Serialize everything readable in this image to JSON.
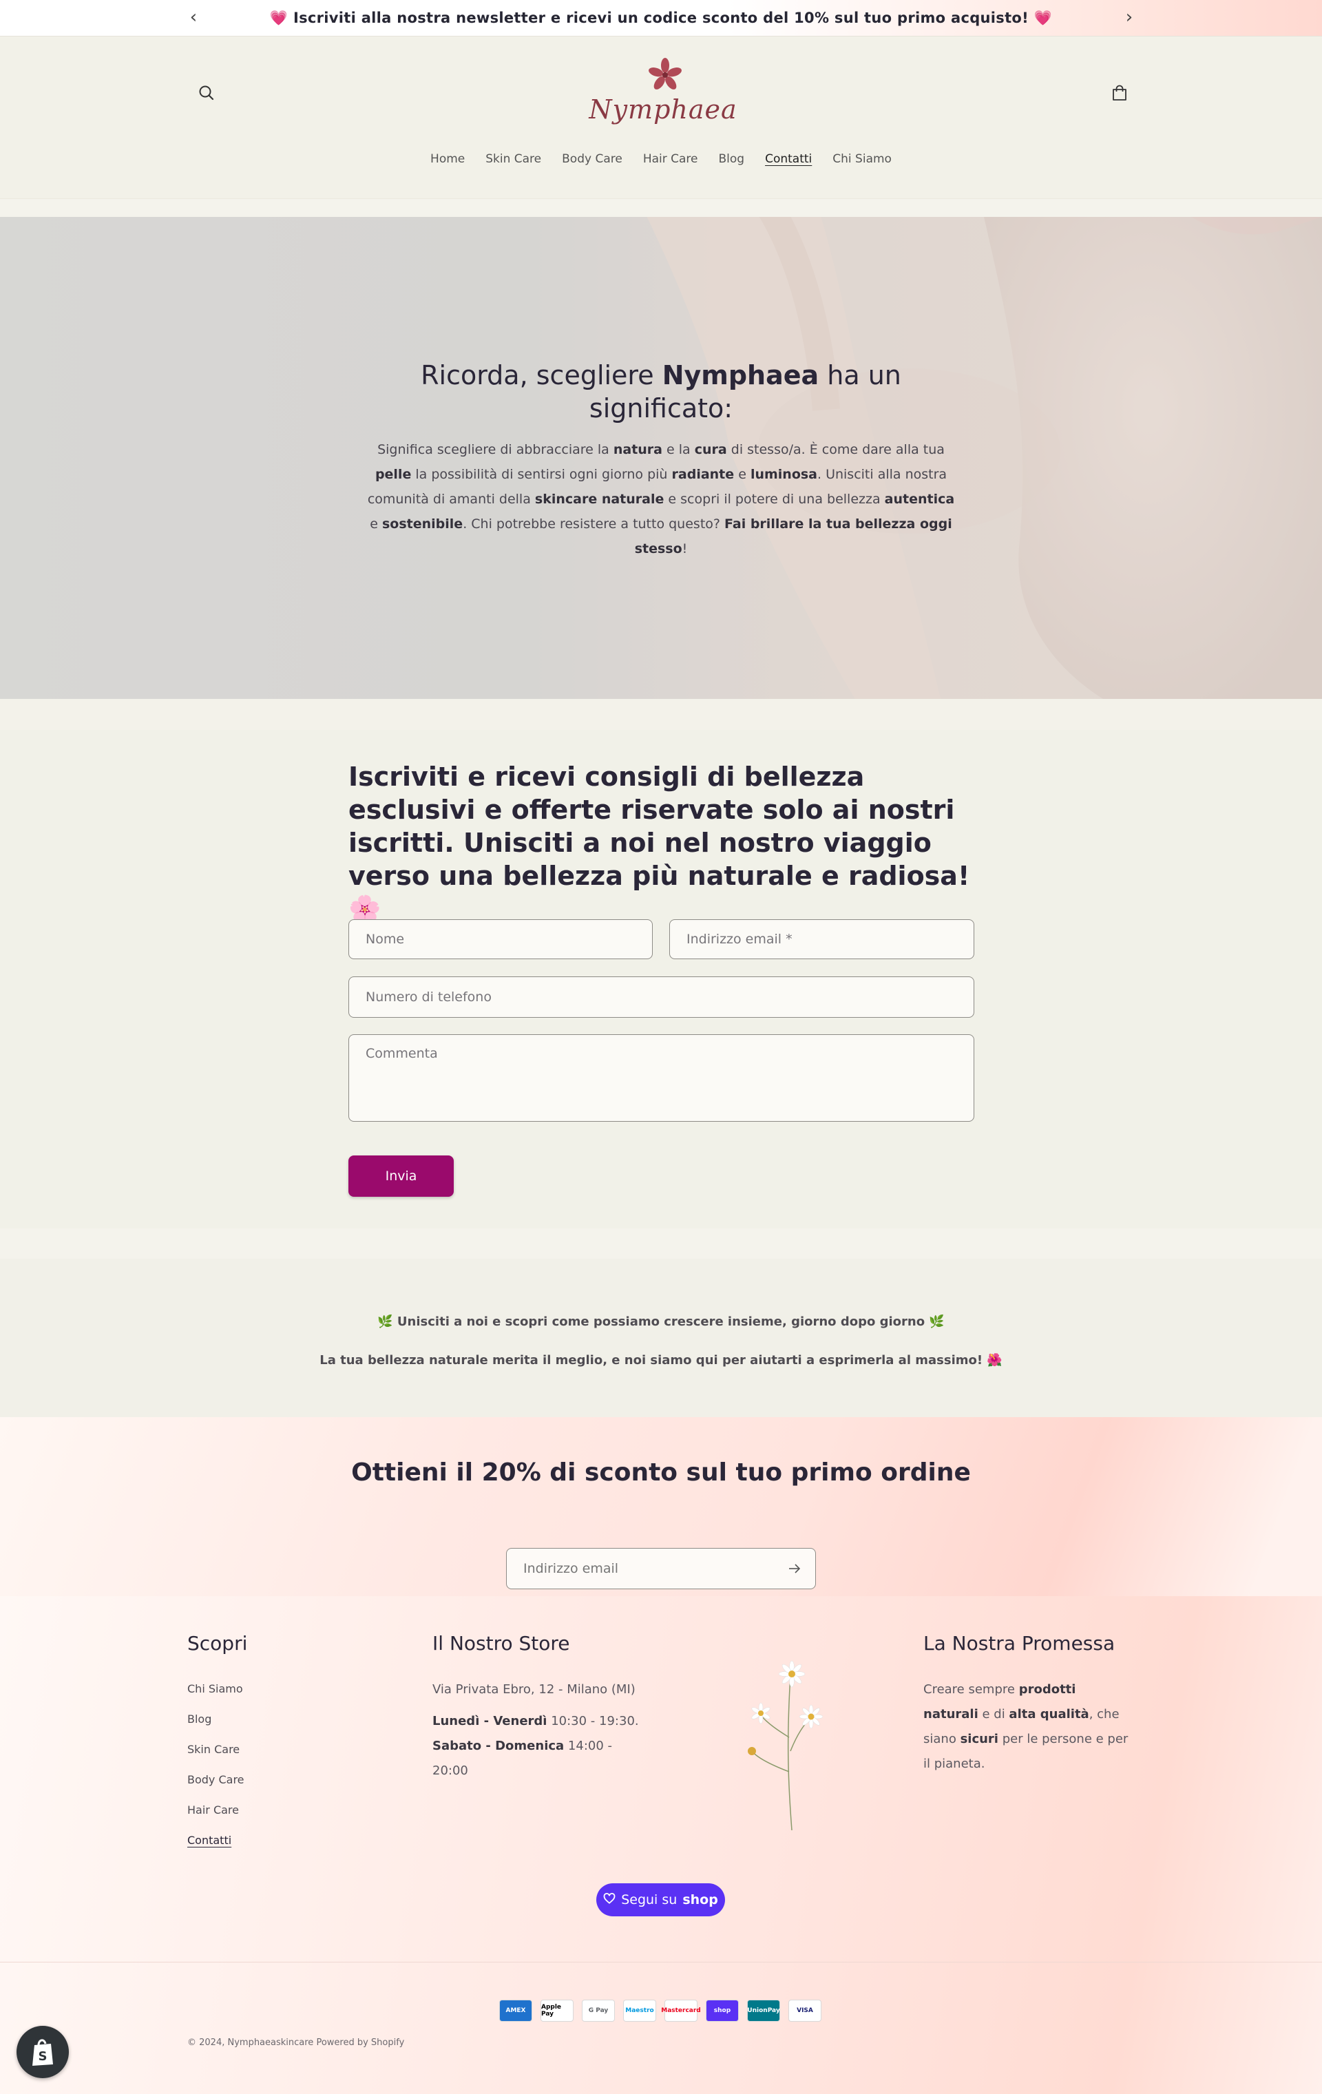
{
  "announcement": {
    "text": "💗 Iscriviti alla nostra newsletter e ricevi un codice sconto del 10% sul tuo primo acquisto! 💗",
    "prev_icon": "chevron-left-icon",
    "next_icon": "chevron-right-icon"
  },
  "header": {
    "logo_text": "Nymphaea",
    "nav": [
      {
        "label": "Home"
      },
      {
        "label": "Skin Care"
      },
      {
        "label": "Body Care"
      },
      {
        "label": "Hair Care"
      },
      {
        "label": "Blog"
      },
      {
        "label": "Contatti",
        "active": true
      },
      {
        "label": "Chi Siamo"
      }
    ]
  },
  "hero": {
    "title_prefix": "Ricorda, scegliere ",
    "title_brand": "Nymphaea",
    "title_suffix": " ha un significato:",
    "text": [
      {
        "t": "Significa scegliere di abbracciare la "
      },
      {
        "b": "natura"
      },
      {
        "t": " e la "
      },
      {
        "b": "cura"
      },
      {
        "t": " di stesso/a. È come dare alla tua "
      },
      {
        "b": "pelle"
      },
      {
        "t": " la possibilità di sentirsi ogni giorno più "
      },
      {
        "b": "radiante"
      },
      {
        "t": " e "
      },
      {
        "b": "luminosa"
      },
      {
        "t": ". Unisciti alla nostra comunità di amanti della "
      },
      {
        "b": "skincare naturale"
      },
      {
        "t": " e scopri il potere di una bellezza "
      },
      {
        "b": "autentica"
      },
      {
        "t": " e "
      },
      {
        "b": "sostenibile"
      },
      {
        "t": ". Chi potrebbe resistere a tutto questo? "
      },
      {
        "b": "Fai brillare la tua bellezza oggi stesso"
      },
      {
        "t": "!"
      }
    ]
  },
  "contact": {
    "title_plain": "Iscriviti e ricevi consigli di bellezza esclusivi e offerte riservate solo ai nostri iscritti. ",
    "title_b1": "Unisciti a noi",
    "title_mid": " nel nostro viaggio verso una bellezza più ",
    "title_b2": "naturale e radiosa",
    "title_end": "! 🌸",
    "name_placeholder": "Nome",
    "email_placeholder": "Indirizzo email *",
    "phone_placeholder": "Numero di telefono",
    "comment_placeholder": "Commenta",
    "submit_label": "Invia",
    "accent_color": "#9a0a6c"
  },
  "promo": {
    "line1": "🌿 Unisciti a noi e scopri come possiamo crescere insieme, giorno dopo giorno 🌿",
    "line2": "La tua bellezza naturale merita il meglio, e noi siamo qui per aiutarti a esprimerla al massimo! 🌺"
  },
  "newsletter": {
    "title": "Ottieni il 20% di sconto sul tuo primo ordine",
    "email_placeholder": "Indirizzo email",
    "submit_icon": "arrow-right-icon"
  },
  "footer": {
    "discover_heading": "Scopri",
    "links": [
      {
        "label": "Chi Siamo"
      },
      {
        "label": "Blog"
      },
      {
        "label": "Skin Care"
      },
      {
        "label": "Body Care"
      },
      {
        "label": "Hair Care"
      },
      {
        "label": "Contatti",
        "active": true
      }
    ],
    "store_heading": "Il Nostro Store",
    "store_address": "Via Privata Ebro, 12 - Milano (MI)",
    "hours_weekday_label": "Lunedì - Venerdì",
    "hours_weekday": " 10:30 - 19:30.",
    "hours_weekend_label": "Sabato - Domenica",
    "hours_weekend": " 14:00 - 20:00",
    "promise_heading": "La Nostra Promessa",
    "promise_text": [
      {
        "t": "Creare sempre "
      },
      {
        "b": "prodotti naturali"
      },
      {
        "t": " e di "
      },
      {
        "b": "alta qualità"
      },
      {
        "t": ", che siano "
      },
      {
        "b": "sicuri"
      },
      {
        "t": " per le persone e per il pianeta."
      }
    ],
    "shop_follow_label": "Segui su",
    "shop_brand": "shop",
    "payments": [
      {
        "name": "AMEX",
        "bg": "#1f72cd",
        "fg": "#ffffff"
      },
      {
        "name": "Apple Pay",
        "bg": "#ffffff",
        "fg": "#000000"
      },
      {
        "name": "G Pay",
        "bg": "#ffffff",
        "fg": "#5f6368"
      },
      {
        "name": "Maestro",
        "bg": "#ffffff",
        "fg": "#0099df"
      },
      {
        "name": "Mastercard",
        "bg": "#ffffff",
        "fg": "#eb001b"
      },
      {
        "name": "shop",
        "bg": "#5a31f4",
        "fg": "#ffffff"
      },
      {
        "name": "UnionPay",
        "bg": "#01798a",
        "fg": "#ffffff"
      },
      {
        "name": "VISA",
        "bg": "#ffffff",
        "fg": "#1a1f71"
      }
    ],
    "copyright": "© 2024, Nymphaeaskincare Powered by Shopify"
  }
}
